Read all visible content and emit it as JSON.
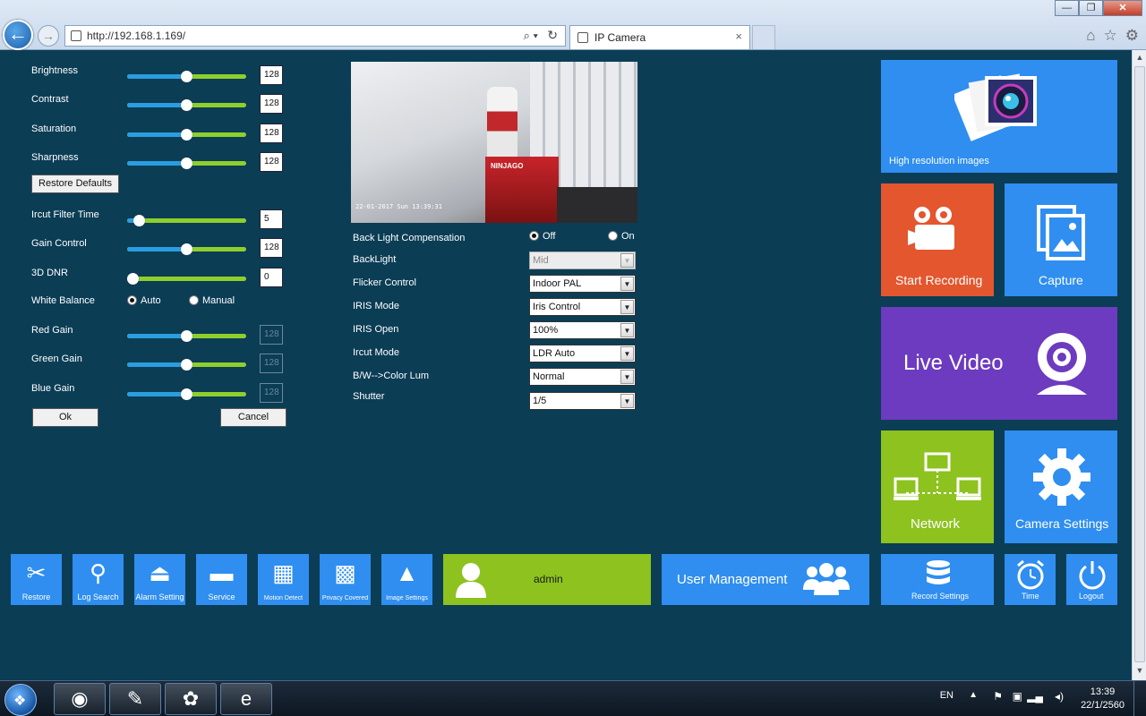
{
  "browser": {
    "url": "http://192.168.1.169/",
    "tab_title": "IP Camera",
    "tab_close": "×",
    "back_icon": "back-arrow-icon",
    "forward_icon": "forward-arrow-icon",
    "search_glyph": "⌕ ▾",
    "refresh_glyph": "↻",
    "minimize": "—",
    "maximize": "❐",
    "close": "✕",
    "home_glyph": "⌂",
    "fav_glyph": "☆",
    "tools_glyph": "⚙"
  },
  "sliders": [
    {
      "label": "Brightness",
      "value": "128",
      "pos": 0.5,
      "disabled": false
    },
    {
      "label": "Contrast",
      "value": "128",
      "pos": 0.5,
      "disabled": false
    },
    {
      "label": "Saturation",
      "value": "128",
      "pos": 0.5,
      "disabled": false
    },
    {
      "label": "Sharpness",
      "value": "128",
      "pos": 0.5,
      "disabled": false
    }
  ],
  "restore_defaults": "Restore Defaults",
  "sliders2": [
    {
      "label": "Ircut Filter Time",
      "value": "5",
      "pos": 0.06,
      "disabled": false
    },
    {
      "label": "Gain Control",
      "value": "128",
      "pos": 0.5,
      "disabled": false
    },
    {
      "label": "3D DNR",
      "value": "0",
      "pos": 0.0,
      "disabled": false
    }
  ],
  "white_balance": {
    "label": "White Balance",
    "auto": "Auto",
    "manual": "Manual",
    "selected": "auto"
  },
  "sliders3": [
    {
      "label": "Red Gain",
      "value": "128",
      "pos": 0.5,
      "disabled": true
    },
    {
      "label": "Green Gain",
      "value": "128",
      "pos": 0.5,
      "disabled": true
    },
    {
      "label": "Blue Gain",
      "value": "128",
      "pos": 0.5,
      "disabled": true
    }
  ],
  "ok": "Ok",
  "cancel": "Cancel",
  "preview": {
    "timestamp": "22-01-2017 Sun 13:39:31",
    "box_text": "NINJAGO"
  },
  "backlight_comp": {
    "label": "Back Light Compensation",
    "off": "Off",
    "on": "On",
    "selected": "off"
  },
  "form": [
    {
      "label": "BackLight",
      "value": "Mid",
      "disabled": true
    },
    {
      "label": "Flicker Control",
      "value": "Indoor PAL",
      "disabled": false
    },
    {
      "label": "IRIS Mode",
      "value": "Iris Control",
      "disabled": false
    },
    {
      "label": "IRIS Open",
      "value": "100%",
      "disabled": false
    },
    {
      "label": "Ircut Mode",
      "value": "LDR Auto",
      "disabled": false
    },
    {
      "label": "B/W-->Color Lum",
      "value": "Normal",
      "disabled": false
    },
    {
      "label": "Shutter",
      "value": "1/5",
      "disabled": false
    }
  ],
  "tiles": {
    "high_res": "High resolution images",
    "start_recording": "Start Recording",
    "capture": "Capture",
    "live_video": "Live Video",
    "network": "Network",
    "camera_settings": "Camera Settings",
    "admin": "admin",
    "user_management": "User Management",
    "record_settings": "Record Settings",
    "time": "Time",
    "logout": "Logout"
  },
  "small_tiles": [
    {
      "label": "Restore",
      "icon": "tools-icon",
      "glyph": "✂"
    },
    {
      "label": "Log Search",
      "icon": "magnifier-icon",
      "glyph": "⚲"
    },
    {
      "label": "Alarm Setting",
      "icon": "alarm-icon",
      "glyph": "⏏"
    },
    {
      "label": "Service",
      "icon": "folder-icon",
      "glyph": "▬"
    },
    {
      "label": "Motion Detect",
      "icon": "motion-grid-icon",
      "glyph": "▦"
    },
    {
      "label": "Privacy Covered",
      "icon": "privacy-grid-icon",
      "glyph": "▩"
    },
    {
      "label": "Image Settings",
      "icon": "image-icon",
      "glyph": "▲"
    }
  ],
  "colors": {
    "background": "#0b3d55",
    "tile_blue": "#2f8ef0",
    "tile_orange": "#e3562e",
    "tile_purple": "#6c3bbf",
    "tile_green": "#8dc21f"
  },
  "taskbar": {
    "lang": "EN",
    "time": "13:39",
    "date": "22/1/2560",
    "apps": [
      {
        "name": "chrome-icon",
        "glyph": "◉"
      },
      {
        "name": "paint-network-icon",
        "glyph": "✎"
      },
      {
        "name": "paint-palette-icon",
        "glyph": "✿"
      },
      {
        "name": "internet-explorer-icon",
        "glyph": "e"
      }
    ]
  }
}
